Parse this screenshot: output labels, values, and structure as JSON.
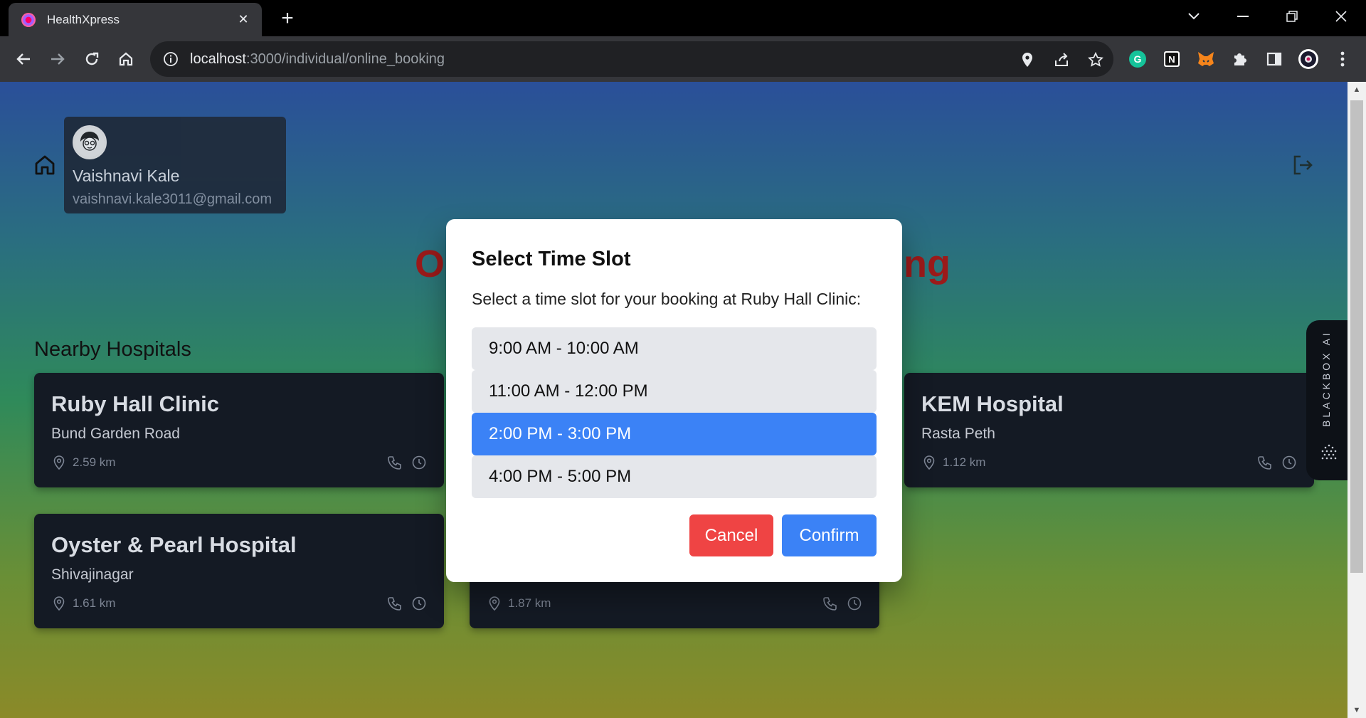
{
  "browser": {
    "tab_title": "HealthXpress",
    "url_host": "localhost",
    "url_path": ":3000/individual/online_booking"
  },
  "user": {
    "name": "Vaishnavi Kale",
    "email": "vaishnavi.kale3011@gmail.com"
  },
  "page": {
    "heading_left": "O",
    "heading_right": "ng",
    "section_title": "Nearby Hospitals"
  },
  "hospitals": [
    {
      "name": "Ruby Hall Clinic",
      "area": "Bund Garden Road",
      "distance": "2.59 km"
    },
    {
      "name": "KEM Hospital",
      "area": "Rasta Peth",
      "distance": "1.12 km"
    },
    {
      "name": "Oyster & Pearl Hospital",
      "area": "Shivajinagar",
      "distance": "1.61 km"
    },
    {
      "name": "",
      "area": "",
      "distance": "1.87 km"
    }
  ],
  "sidebar_widget": {
    "label": "BLACKBOX AI"
  },
  "modal": {
    "title": "Select Time Slot",
    "description": "Select a time slot for your booking at Ruby Hall Clinic:",
    "slots": [
      "9:00 AM - 10:00 AM",
      "11:00 AM - 12:00 PM",
      "2:00 PM - 3:00 PM",
      "4:00 PM - 5:00 PM"
    ],
    "selected_slot": "2:00 PM - 3:00 PM",
    "cancel_label": "Cancel",
    "confirm_label": "Confirm"
  },
  "colors": {
    "accent": "#3b82f6",
    "danger": "#ef4444",
    "heading": "#9b1a1a"
  }
}
